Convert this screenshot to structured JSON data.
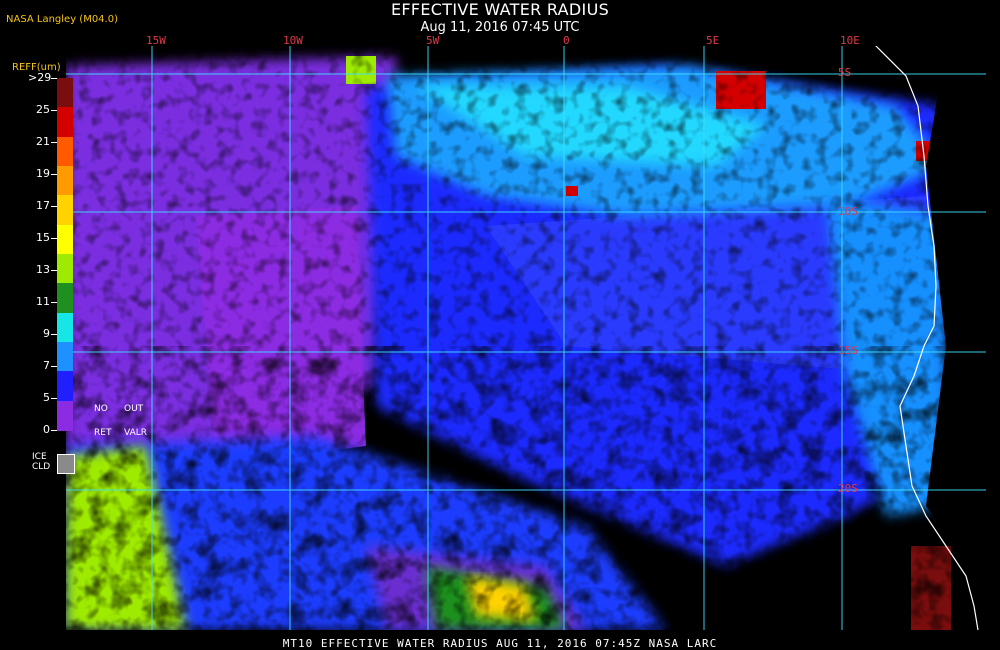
{
  "header": {
    "title": "EFFECTIVE WATER RADIUS",
    "subtitle": "Aug 11, 2016 07:45 UTC",
    "producer": "NASA Langley (M04.0)"
  },
  "map": {
    "longitude_labels": [
      "15W",
      "10W",
      "5W",
      "0",
      "5E",
      "10E"
    ],
    "latitude_labels": [
      "5S",
      "10S",
      "15S",
      "20S"
    ],
    "gridline_color": "#3fe0ff",
    "coastline_color": "#ffffff",
    "label_color": "#e0384a"
  },
  "legend": {
    "title": "REFF(um)",
    "tick_labels": [
      ">29",
      "25",
      "21",
      "19",
      "17",
      "15",
      "13",
      "11",
      "9",
      "7",
      "5",
      "0"
    ],
    "colors": [
      "#7a0d0d",
      "#d40000",
      "#ff5a00",
      "#ff9a00",
      "#ffd200",
      "#ffff00",
      "#9eea00",
      "#1f8f1f",
      "#17e6e6",
      "#1e90ff",
      "#1f1fff",
      "#8b2be2"
    ],
    "no_ret_line1": "NO",
    "no_ret_line2": "RET",
    "out_valr_line1": "OUT",
    "out_valr_line2": "VALR",
    "ice_label_line1": "ICE",
    "ice_label_line2": "CLD",
    "ice_color": "#8a8a8a"
  },
  "footer": {
    "text": "MT10  EFFECTIVE WATER RADIUS   AUG 11, 2016 07:45Z   NASA LARC"
  }
}
